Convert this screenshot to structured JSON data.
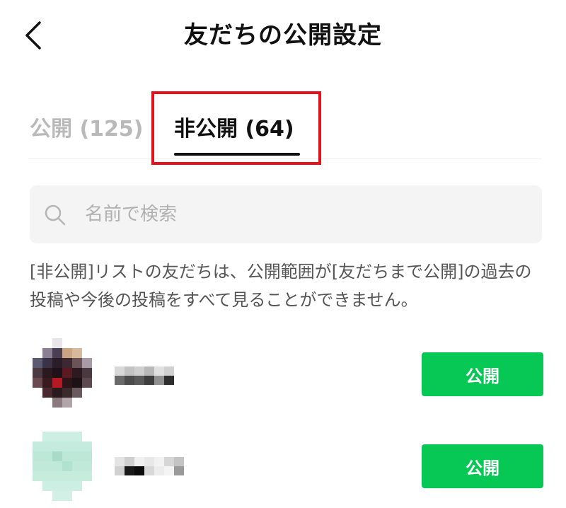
{
  "header": {
    "title": "友だちの公開設定",
    "back_icon": "chevron-left-icon"
  },
  "tabs": [
    {
      "label": "公開 (125)",
      "selected": false
    },
    {
      "label": "非公開 (64)",
      "selected": true
    }
  ],
  "search": {
    "placeholder": "名前で検索",
    "value": "",
    "icon": "search-icon"
  },
  "notice": "[非公開]リストの友だちは、公開範囲が[友だちまで公開]の過去の投稿や今後の投稿をすべて見ることができません。",
  "friends": [
    {
      "button_label": "公開"
    },
    {
      "button_label": "公開"
    }
  ],
  "colors": {
    "accent_green": "#07c755",
    "highlight_red": "#e4131b",
    "inactive_tab": "#b9b9b9"
  }
}
